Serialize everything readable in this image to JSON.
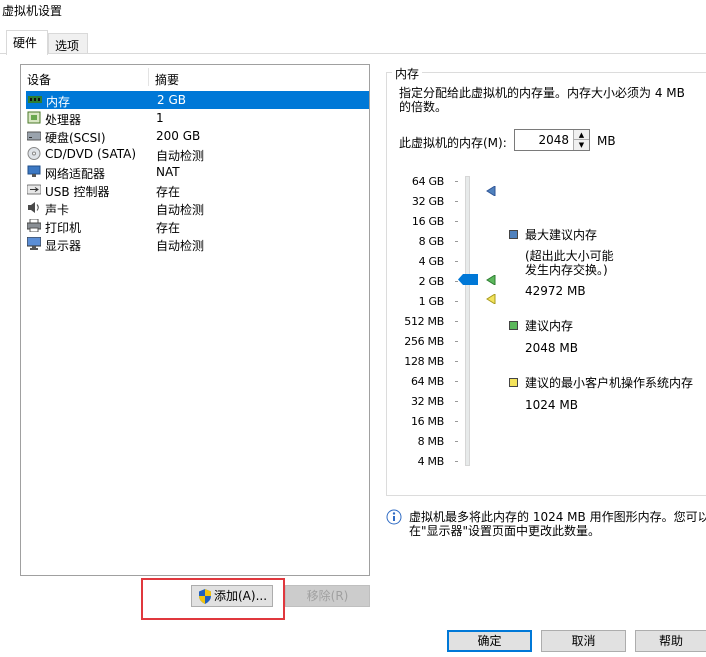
{
  "window": {
    "title": "虚拟机设置"
  },
  "tabs": [
    {
      "label": "硬件",
      "active": true
    },
    {
      "label": "选项",
      "active": false
    }
  ],
  "device_list": {
    "columns": [
      "设备",
      "摘要"
    ],
    "rows": [
      {
        "name": "内存",
        "summary": "2 GB",
        "icon": "memory-icon",
        "selected": true
      },
      {
        "name": "处理器",
        "summary": "1",
        "icon": "processor-icon",
        "selected": false
      },
      {
        "name": "硬盘(SCSI)",
        "summary": "200 GB",
        "icon": "hard-disk-icon",
        "selected": false
      },
      {
        "name": "CD/DVD (SATA)",
        "summary": "自动检测",
        "icon": "cd-dvd-icon",
        "selected": false
      },
      {
        "name": "网络适配器",
        "summary": "NAT",
        "icon": "network-adapter-icon",
        "selected": false
      },
      {
        "name": "USB 控制器",
        "summary": "存在",
        "icon": "usb-icon",
        "selected": false
      },
      {
        "name": "声卡",
        "summary": "自动检测",
        "icon": "speaker-icon",
        "selected": false
      },
      {
        "name": "打印机",
        "summary": "存在",
        "icon": "printer-icon",
        "selected": false
      },
      {
        "name": "显示器",
        "summary": "自动检测",
        "icon": "monitor-icon",
        "selected": false
      }
    ]
  },
  "buttons": {
    "add": "添加(A)...",
    "remove": "移除(R)",
    "ok": "确定",
    "cancel": "取消",
    "help": "帮助"
  },
  "memory": {
    "group_title": "内存",
    "description": "指定分配给此虚拟机的内存量。内存大小必须为 4 MB 的倍数。",
    "label": "此虚拟机的内存(M):",
    "value": "2048",
    "unit": "MB",
    "scale": [
      "64 GB",
      "32 GB",
      "16 GB",
      "8 GB",
      "4 GB",
      "2 GB",
      "1 GB",
      "512 MB",
      "256 MB",
      "128 MB",
      "64 MB",
      "32 MB",
      "16 MB",
      "8 MB",
      "4 MB"
    ],
    "legend": {
      "max_title": "最大建议内存",
      "max_note_1": "(超出此大小可能",
      "max_note_2": "发生内存交换。)",
      "max_value": "42972 MB",
      "rec_title": "建议内存",
      "rec_value": "2048 MB",
      "min_title": "建议的最小客户机操作系统内存",
      "min_value": "1024 MB"
    },
    "info_line_1": "虚拟机最多将此内存的 1024 MB 用作图形内存。您可以",
    "info_line_2": "在\"显示器\"设置页面中更改此数量。"
  },
  "colors": {
    "selection": "#0078d7",
    "max_marker": "#4f81bd",
    "rec_marker": "#5cb85c",
    "min_marker": "#f3e35c",
    "highlight_box": "#e0383e"
  }
}
